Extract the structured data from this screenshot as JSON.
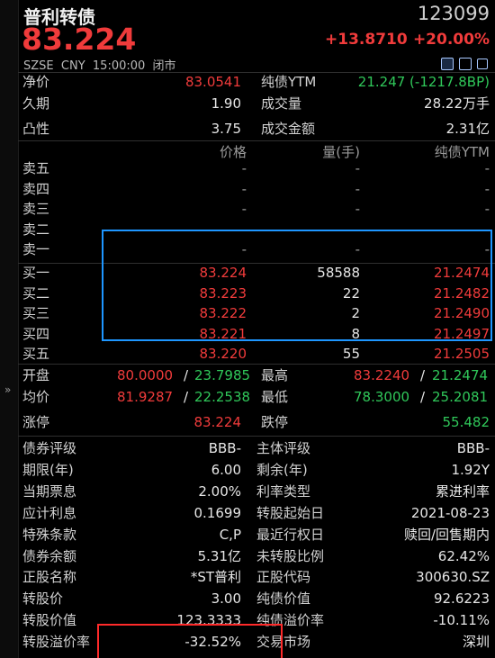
{
  "header": {
    "name": "普利转债",
    "code": "123099",
    "price": "83.224",
    "change": "+13.8710",
    "change_pct": "+20.00%",
    "meta": "SZSE  CNY  15:00:00  闭市"
  },
  "icons": [
    "edit-icon",
    "window-icon",
    "square-icon",
    "expand-icon"
  ],
  "summary": {
    "net_value_label": "净价",
    "net_value": "83.0541",
    "bond_ytm_label": "纯债YTM",
    "bond_ytm": "21.247 (-1217.8BP)",
    "duration_label": "久期",
    "duration": "1.90",
    "volume_label": "成交量",
    "volume": "28.22万手",
    "convexity_label": "凸性",
    "convexity": "3.75",
    "amount_label": "成交金额",
    "amount": "2.31亿"
  },
  "book": {
    "col_price": "价格",
    "col_qty": "量(手)",
    "col_ytm": "纯债YTM",
    "asks": [
      {
        "label": "卖五",
        "price": "-",
        "qty": "-",
        "ytm": "-"
      },
      {
        "label": "卖四",
        "price": "-",
        "qty": "-",
        "ytm": "-"
      },
      {
        "label": "卖三",
        "price": "-",
        "qty": "-",
        "ytm": "-"
      },
      {
        "label": "卖二",
        "price": "-",
        "qty": "-",
        "ytm": "-"
      },
      {
        "label": "卖一",
        "price": "-",
        "qty": "-",
        "ytm": "-"
      }
    ],
    "bids": [
      {
        "label": "买一",
        "price": "83.224",
        "qty": "58588",
        "ytm": "21.2474"
      },
      {
        "label": "买二",
        "price": "83.223",
        "qty": "22",
        "ytm": "21.2482"
      },
      {
        "label": "买三",
        "price": "83.222",
        "qty": "2",
        "ytm": "21.2490"
      },
      {
        "label": "买四",
        "price": "83.221",
        "qty": "8",
        "ytm": "21.2497"
      },
      {
        "label": "买五",
        "price": "83.220",
        "qty": "55",
        "ytm": "21.2505"
      }
    ]
  },
  "quote": {
    "open_label": "开盘",
    "open_price": "80.0000",
    "slash": "/",
    "open_ytm": "23.7985",
    "high_label": "最高",
    "high_price": "83.2240",
    "high_ytm": "21.2474",
    "avg_label": "均价",
    "avg_price": "81.9287",
    "avg_ytm": "22.2538",
    "low_label": "最低",
    "low_price": "78.3000",
    "low_ytm": "25.2081",
    "limit_up_label": "涨停",
    "limit_up": "83.224",
    "limit_down_label": "跌停",
    "limit_down": "55.482"
  },
  "info": [
    {
      "l1": "债券评级",
      "v1": "BBB-",
      "l2": "主体评级",
      "v2": "BBB-"
    },
    {
      "l1": "期限(年)",
      "v1": "6.00",
      "l2": "剩余(年)",
      "v2": "1.92Y"
    },
    {
      "l1": "当期票息",
      "v1": "2.00%",
      "l2": "利率类型",
      "v2": "累进利率"
    },
    {
      "l1": "应计利息",
      "v1": "0.1699",
      "l2": "转股起始日",
      "v2": "2021-08-23"
    },
    {
      "l1": "特殊条款",
      "v1": "C,P",
      "l2": "最近行权日",
      "v2": "赎回/回售期内"
    },
    {
      "l1": "债券余额",
      "v1": "5.31亿",
      "l2": "未转股比例",
      "v2": "62.42%"
    },
    {
      "l1": "正股名称",
      "v1": "*ST普利",
      "l2": "正股代码",
      "v2": "300630.SZ"
    },
    {
      "l1": "转股价",
      "v1": "3.00",
      "l2": "纯债价值",
      "v2": "92.6223"
    },
    {
      "l1": "转股价值",
      "v1": "123.3333",
      "l2": "纯债溢价率",
      "v2": "-10.11%"
    },
    {
      "l1": "转股溢价率",
      "v1": "-32.52%",
      "l2": "交易市场",
      "v2": "深圳"
    }
  ],
  "colors": {
    "up": "#f03b3b",
    "down": "#30c85a",
    "highlight_box": "#1e96ff",
    "mark_box": "#ff2a2a"
  }
}
